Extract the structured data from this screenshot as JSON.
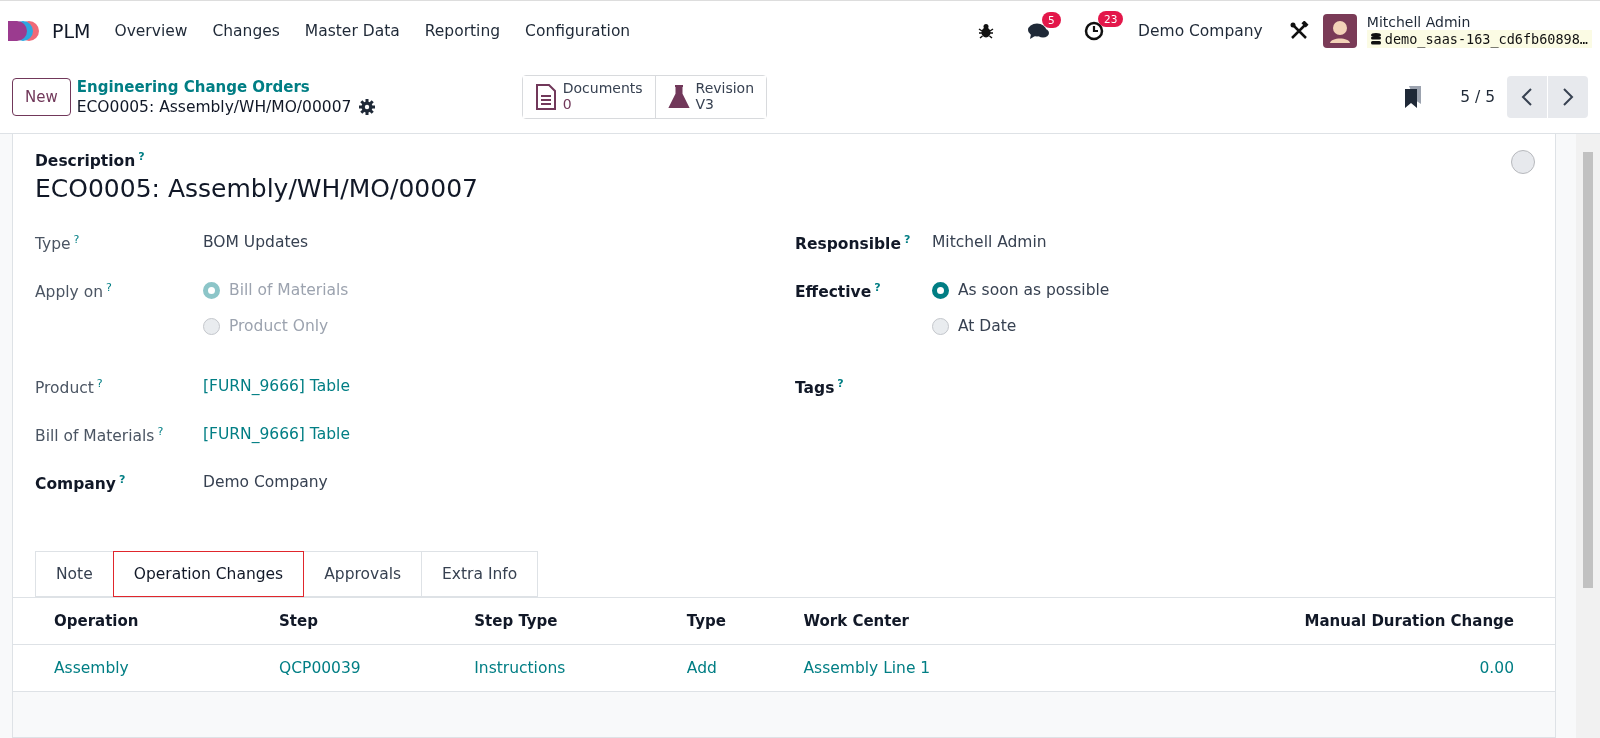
{
  "app": {
    "name": "PLM"
  },
  "menu": [
    "Overview",
    "Changes",
    "Master Data",
    "Reporting",
    "Configuration"
  ],
  "systray": {
    "messages_count": "5",
    "activities_count": "23",
    "company": "Demo Company",
    "user": "Mitchell Admin",
    "database": "demo_saas-163_cd6fb60898…"
  },
  "control_panel": {
    "new_button": "New",
    "breadcrumb": "Engineering Change Orders",
    "record": "ECO0005: Assembly/WH/MO/00007",
    "smart_buttons": [
      {
        "kind": "documents",
        "label": "Documents",
        "value": "0"
      },
      {
        "kind": "revision",
        "label": "Revision",
        "value": "V3"
      }
    ],
    "pager": "5 / 5"
  },
  "form": {
    "description_label": "Description",
    "help": "?",
    "title": "ECO0005: Assembly/WH/MO/00007",
    "left_fields": [
      {
        "kind": "text",
        "label": "Type",
        "bold": false,
        "value": "BOM Updates"
      },
      {
        "kind": "radio",
        "label": "Apply on",
        "bold": false,
        "disabled": true,
        "options": [
          {
            "label": "Bill of Materials",
            "selected": true
          },
          {
            "label": "Product Only",
            "selected": false
          }
        ]
      },
      {
        "kind": "link",
        "label": "Product",
        "bold": false,
        "value": "[FURN_9666] Table"
      },
      {
        "kind": "link",
        "label": "Bill of Materials",
        "bold": false,
        "value": "[FURN_9666] Table"
      },
      {
        "kind": "text",
        "label": "Company",
        "bold": true,
        "value": "Demo Company"
      }
    ],
    "right_fields": [
      {
        "kind": "text",
        "label": "Responsible",
        "bold": true,
        "value": "Mitchell Admin"
      },
      {
        "kind": "radio",
        "label": "Effective",
        "bold": true,
        "disabled": false,
        "options": [
          {
            "label": "As soon as possible",
            "selected": true
          },
          {
            "label": "At Date",
            "selected": false
          }
        ]
      },
      {
        "kind": "empty",
        "label": "Tags",
        "bold": true
      }
    ]
  },
  "tabs": [
    {
      "label": "Note",
      "selected": false
    },
    {
      "label": "Operation Changes",
      "selected": true
    },
    {
      "label": "Approvals",
      "selected": false
    },
    {
      "label": "Extra Info",
      "selected": false
    }
  ],
  "table": {
    "columns": [
      "Operation",
      "Step",
      "Step Type",
      "Type",
      "Work Center",
      "Manual Duration Change"
    ],
    "rows": [
      [
        "Assembly",
        "QCP00039",
        "Instructions",
        "Add",
        "Assembly Line 1",
        "0.00"
      ]
    ]
  }
}
